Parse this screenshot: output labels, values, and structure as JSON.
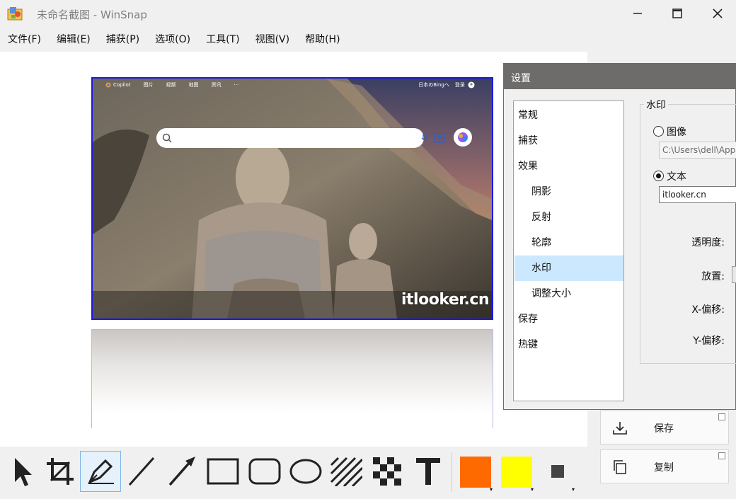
{
  "window": {
    "title": "未命名截图 - WinSnap",
    "minimize_icon": "minimize-icon",
    "maximize_icon": "maximize-icon",
    "close_icon": "close-icon"
  },
  "menu": [
    "文件(F)",
    "编辑(E)",
    "捕获(P)",
    "选项(O)",
    "工具(T)",
    "视图(V)",
    "帮助(H)"
  ],
  "screenshot": {
    "nav": [
      "Copilot",
      "图片",
      "视频",
      "地图",
      "资讯",
      "···"
    ],
    "nav_right": [
      "日本のBingへ",
      "登录"
    ],
    "watermark_text": "itlooker.cn"
  },
  "side_panel": {
    "save_label": "保存",
    "copy_label": "复制"
  },
  "dialog": {
    "title": "设置",
    "nav": {
      "general": "常规",
      "capture": "捕获",
      "effects": "效果",
      "shadow": "阴影",
      "reflection": "反射",
      "outline": "轮廓",
      "watermark": "水印",
      "resize": "调整大小",
      "save": "保存",
      "hotkeys": "热键"
    },
    "selected": "水印",
    "group_title": "水印",
    "image_option": "图像",
    "image_path": "C:\\Users\\dell\\AppD",
    "text_option": "文本",
    "text_value": "itlooker.cn",
    "opacity_label": "透明度:",
    "placement_label": "放置:",
    "x_offset_label": "X-偏移:",
    "y_offset_label": "Y-偏移:"
  },
  "toolbar": {
    "tools": [
      "pointer-icon",
      "crop-icon",
      "pen-icon",
      "line-icon",
      "arrow-icon",
      "rectangle-icon",
      "rounded-rectangle-icon",
      "ellipse-icon",
      "hatch-icon",
      "pixelate-icon",
      "text-icon"
    ],
    "colors": {
      "primary": "#ff6a00",
      "secondary": "#ffff00",
      "tertiary": "#444444"
    }
  },
  "colors": {
    "selection_border": "#1a1ae6",
    "nav_selected_bg": "#cce8ff",
    "dialog_title_bg": "#6e6c6b"
  }
}
